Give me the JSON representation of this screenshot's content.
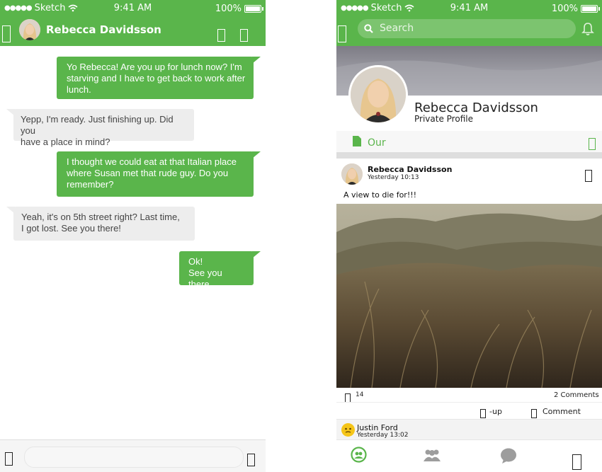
{
  "status": {
    "carrier": "Sketch",
    "time": "9:41 AM",
    "battery": "100%",
    "battery_level": 1.0
  },
  "chat": {
    "contact_name": "Rebecca Davidsson",
    "messages": [
      {
        "direction": "out",
        "text": "Yo Rebecca! Are you up for lunch now? I'm\nstarving and I have to get back to work after\nlunch."
      },
      {
        "direction": "in",
        "text": "Yepp, I'm ready. Just finishing up. Did you\nhave a place in mind?"
      },
      {
        "direction": "out",
        "text": "I thought we could eat at that Italian place\nwhere Susan met that rude guy. Do you\nremember?"
      },
      {
        "direction": "in",
        "text": "Yeah, it's on 5th street right? Last time,\nI got lost. See you there!"
      },
      {
        "direction": "out",
        "text": "Ok!\nSee you there."
      }
    ],
    "composer_placeholder": ""
  },
  "profile": {
    "search_placeholder": "Search",
    "name": "Rebecca Davidsson",
    "subtitle": "Private Profile",
    "pager_tab": "Our",
    "post": {
      "author": "Rebecca Davidsson",
      "time": "Yesterday 10:13",
      "text": "A view to die for!!!",
      "likes": "14",
      "comments_count": "2 Comments",
      "action_thumbs": "-up",
      "action_comment": "Comment"
    },
    "comment": {
      "author": "Justin Ford",
      "time": "Yesterday 13:02"
    }
  },
  "colors": {
    "accent": "#5ab54b",
    "incoming_bubble": "#ededed"
  },
  "icons": [
    "wifi-icon",
    "battery-icon",
    "back-icon",
    "phone-icon",
    "video-icon",
    "camera-icon",
    "send-icon",
    "search-icon",
    "bell-icon",
    "document-icon",
    "more-icon",
    "like-icon",
    "comment-icon",
    "home-icon",
    "friends-icon",
    "chat-icon",
    "profile-icon"
  ]
}
